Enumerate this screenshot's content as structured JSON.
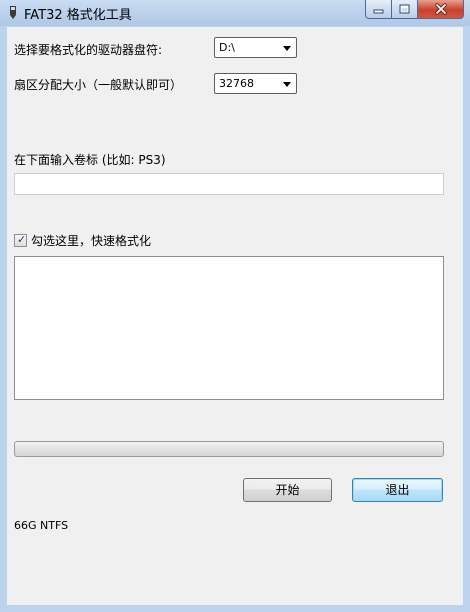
{
  "window": {
    "title": "FAT32 格式化工具"
  },
  "drive": {
    "label": "选择要格式化的驱动器盘符:",
    "value": "D:\\"
  },
  "sector": {
    "label": "扇区分配大小（一般默认即可）",
    "value": "32768"
  },
  "volume": {
    "label": "在下面输入卷标 (比如: PS3)",
    "value": ""
  },
  "quick_format": {
    "label": "勾选这里，快速格式化",
    "checked": true
  },
  "log": {
    "text": ""
  },
  "progress": {
    "value": 0
  },
  "buttons": {
    "start": "开始",
    "exit": "退出"
  },
  "status": {
    "text": "66G NTFS"
  },
  "icons": {
    "app": "app-icon",
    "minimize": "minimize-icon",
    "maximize": "maximize-icon",
    "close": "close-icon",
    "dropdown": "chevron-down-icon",
    "check": "checkmark-icon"
  },
  "colors": {
    "titlebar": "#bcd3ec",
    "client": "#f0f0f0",
    "close": "#c7412c",
    "default_button": "#3c7fb1"
  }
}
